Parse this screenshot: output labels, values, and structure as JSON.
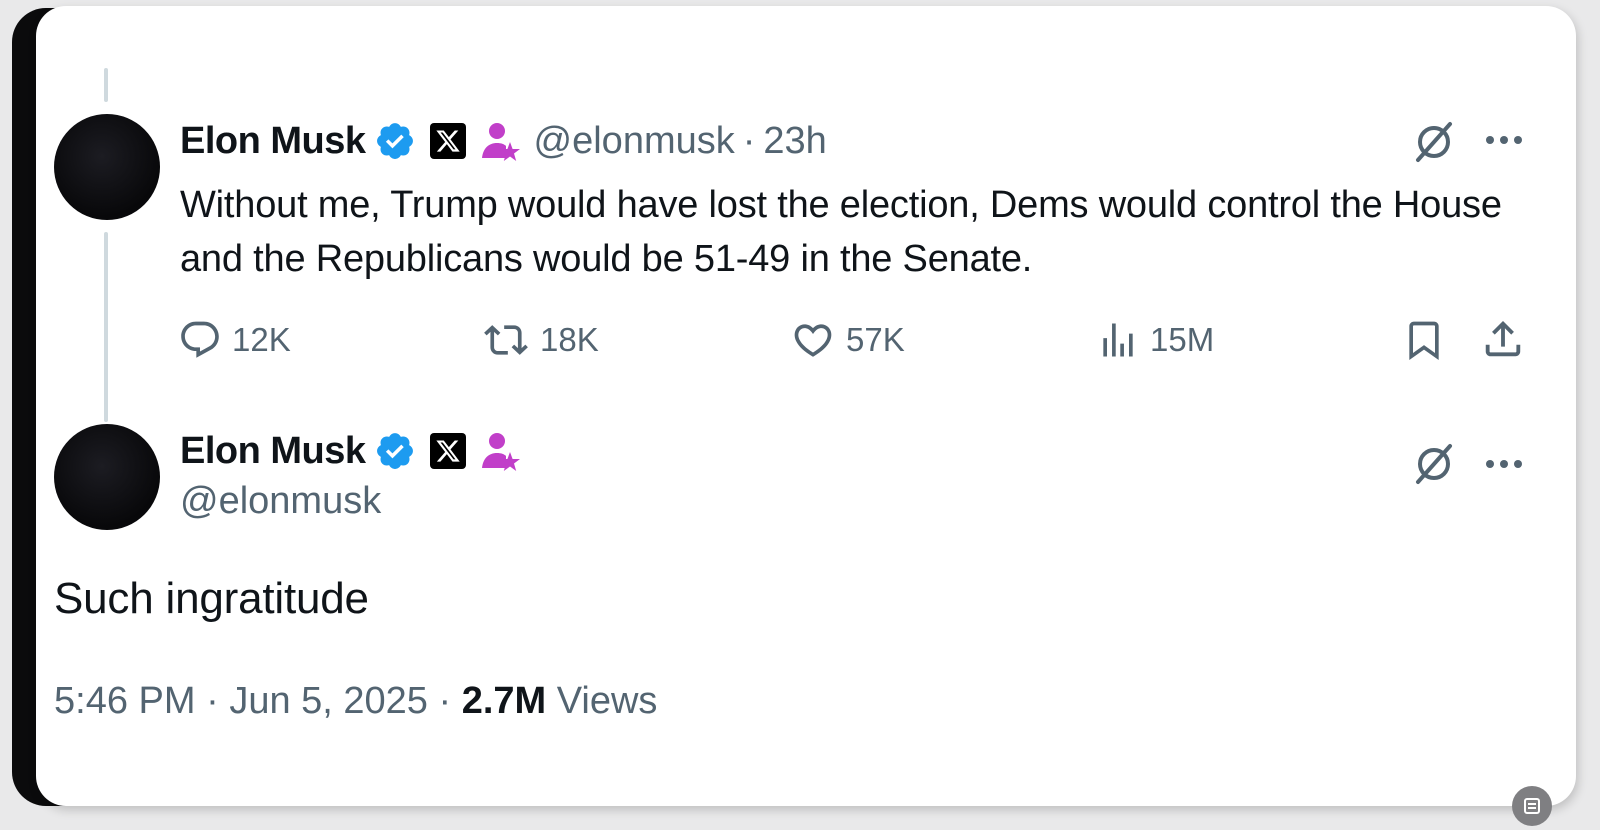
{
  "colors": {
    "verified": "#1d9bf0",
    "affiliate": "#c13fc9",
    "muted": "#536471",
    "text": "#0f1419",
    "thread_line": "#cfd9de"
  },
  "parent_tweet": {
    "author_name": "Elon Musk",
    "handle": "@elonmusk",
    "separator": "·",
    "time_ago": "23h",
    "text": "Without me, Trump would have lost the election, Dems would control the House and the Republicans would be 51-49 in the Senate.",
    "actions": {
      "replies": "12K",
      "reposts": "18K",
      "likes": "57K",
      "views": "15M"
    },
    "icons": [
      "verified-badge-icon",
      "x-logo-icon",
      "affiliate-person-icon",
      "grok-icon",
      "more-icon",
      "reply-icon",
      "repost-icon",
      "like-icon",
      "views-icon",
      "bookmark-icon",
      "share-icon"
    ]
  },
  "reply_tweet": {
    "author_name": "Elon Musk",
    "handle": "@elonmusk",
    "text": "Such ingratitude",
    "time": "5:46 PM",
    "sep1": "·",
    "date": "Jun 5, 2025",
    "sep2": "·",
    "views_count": "2.7M",
    "views_label": "Views"
  }
}
